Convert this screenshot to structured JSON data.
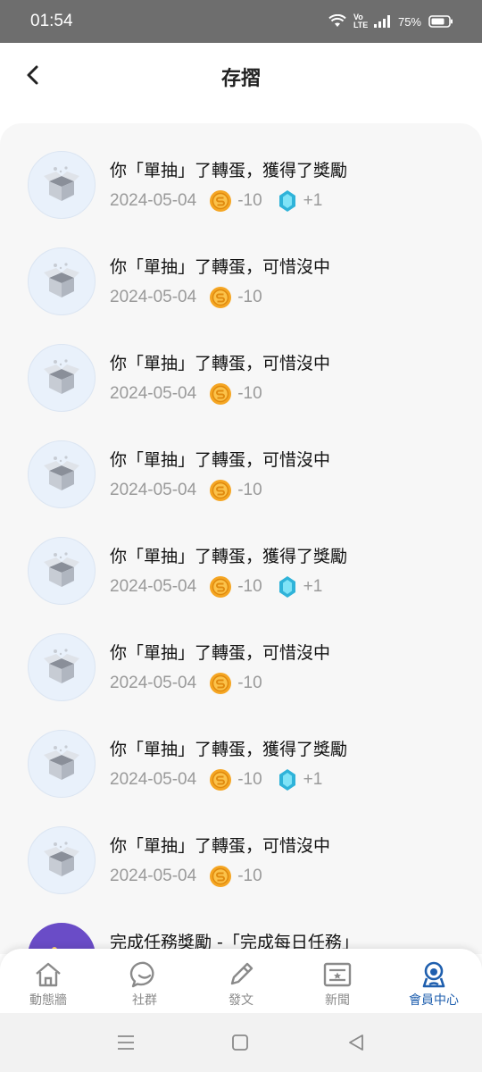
{
  "status_bar": {
    "time": "01:54",
    "network": "Vo LTE",
    "battery": "75%"
  },
  "header": {
    "title": "存摺"
  },
  "entries": [
    {
      "title": "你「單抽」了轉蛋，獲得了獎勵",
      "date": "2024-05-04",
      "coin": "-10",
      "gem": "+1"
    },
    {
      "title": "你「單抽」了轉蛋，可惜沒中",
      "date": "2024-05-04",
      "coin": "-10"
    },
    {
      "title": "你「單抽」了轉蛋，可惜沒中",
      "date": "2024-05-04",
      "coin": "-10"
    },
    {
      "title": "你「單抽」了轉蛋，可惜沒中",
      "date": "2024-05-04",
      "coin": "-10"
    },
    {
      "title": "你「單抽」了轉蛋，獲得了獎勵",
      "date": "2024-05-04",
      "coin": "-10",
      "gem": "+1"
    },
    {
      "title": "你「單抽」了轉蛋，可惜沒中",
      "date": "2024-05-04",
      "coin": "-10"
    },
    {
      "title": "你「單抽」了轉蛋，獲得了獎勵",
      "date": "2024-05-04",
      "coin": "-10",
      "gem": "+1"
    },
    {
      "title": "你「單抽」了轉蛋，可惜沒中",
      "date": "2024-05-04",
      "coin": "-10"
    },
    {
      "title": "完成任務獎勵 -「完成每日任務」"
    }
  ],
  "bottom_nav": [
    {
      "label": "動態牆",
      "icon": "home-icon"
    },
    {
      "label": "社群",
      "icon": "chat-bubble-icon"
    },
    {
      "label": "發文",
      "icon": "pencil-icon"
    },
    {
      "label": "新聞",
      "icon": "news-icon"
    },
    {
      "label": "會員中心",
      "icon": "member-icon",
      "active": true
    }
  ],
  "colors": {
    "active": "#1f5fae",
    "inactive": "#8a8a8a",
    "coin": "#f5a623",
    "gem": "#3fc6e8"
  }
}
